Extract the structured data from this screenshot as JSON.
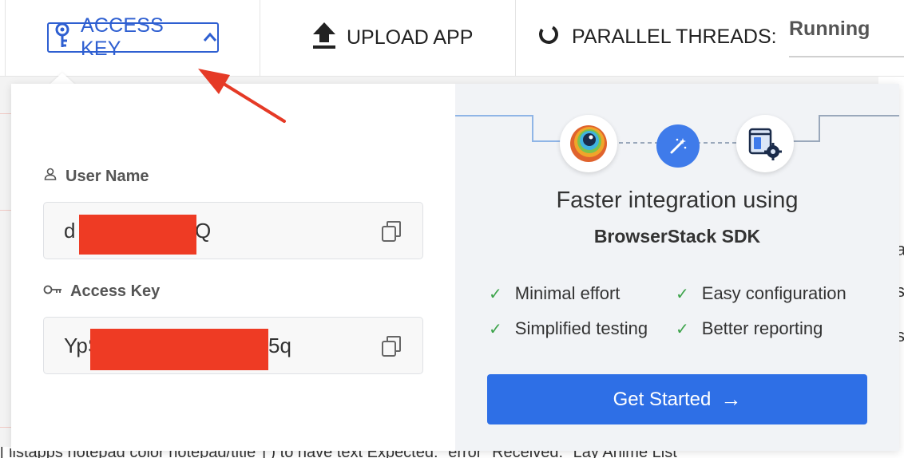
{
  "topbar": {
    "access_key_label": "ACCESS KEY",
    "upload_label": "UPLOAD APP",
    "threads_label": "PARALLEL THREADS:",
    "running_label": "Running"
  },
  "credentials": {
    "username_label": "User Name",
    "username_prefix": "d",
    "username_suffix": "Q",
    "access_key_label": "Access Key",
    "access_key_prefix": "YpS",
    "access_key_suffix": "5q"
  },
  "promo": {
    "title": "Faster integration using",
    "subtitle": "BrowserStack SDK",
    "features": [
      "Minimal effort",
      "Easy configuration",
      "Simplified testing",
      "Better reporting"
    ],
    "cta_label": "Get Started",
    "cta_arrow": "→",
    "check_glyph": "✓"
  },
  "background": {
    "right_chars": [
      "a",
      "s",
      "s"
    ],
    "bottom_text": "[ ilstapps notepad color notepad/title\"] ) to have text  Expected: \"error\"  Received: \"Lay Anime List\""
  },
  "colors": {
    "accent_blue": "#2e5fd1",
    "cta_blue": "#2e6fe6",
    "check_green": "#3ca34a",
    "redaction": "#ee3b24",
    "annotation_red": "#e53a26"
  },
  "icons": {
    "access_key": "key-icon",
    "upload": "upload-icon",
    "threads": "spinner-icon",
    "username": "user-icon",
    "access_key_field": "key-icon",
    "copy": "copy-icon",
    "step1": "browserstack-logo-icon",
    "step2": "magic-wand-icon",
    "step3": "app-settings-icon"
  }
}
